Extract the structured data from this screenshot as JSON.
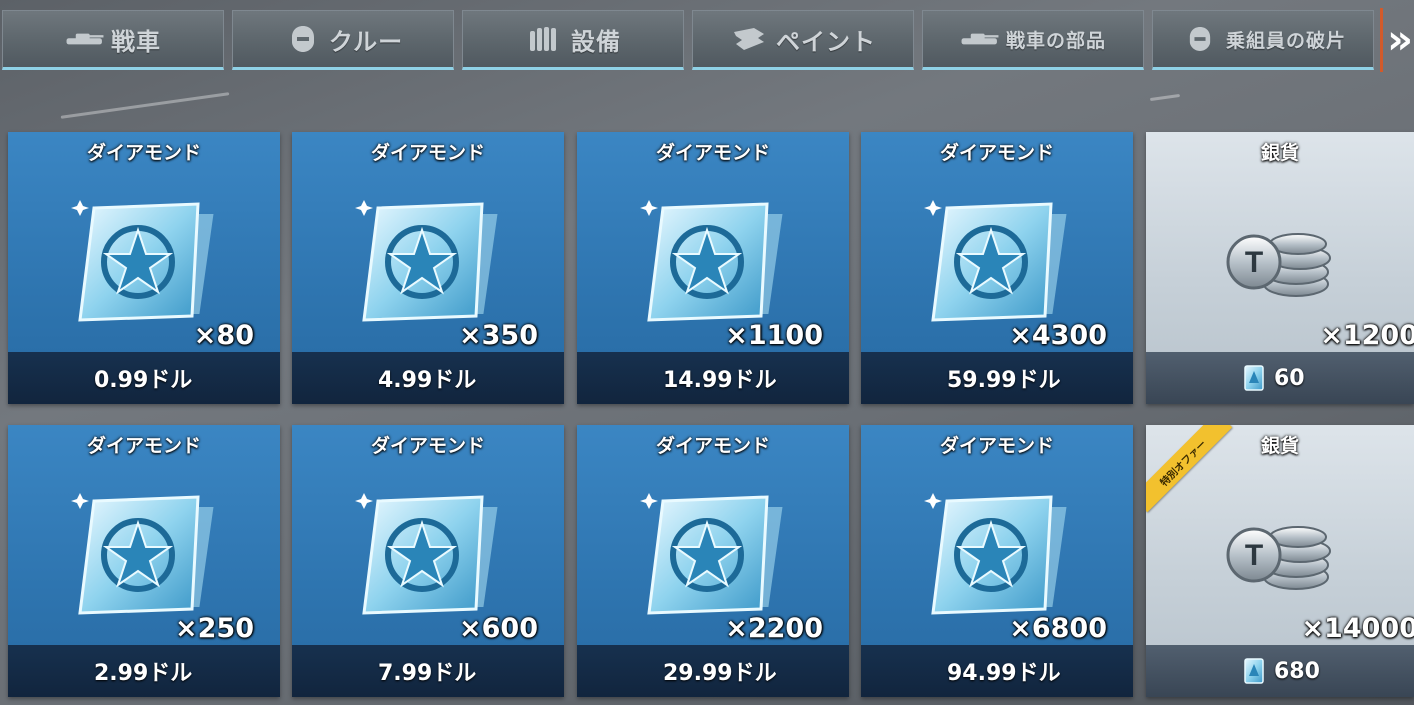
{
  "tabs": [
    {
      "label": "戦車",
      "icon": "tank-icon"
    },
    {
      "label": "クルー",
      "icon": "crew-helmet-icon"
    },
    {
      "label": "設備",
      "icon": "shells-icon"
    },
    {
      "label": "ペイント",
      "icon": "paint-icon"
    },
    {
      "label": "戦車の部品",
      "icon": "tank-icon"
    },
    {
      "label": "乗組員の破片",
      "icon": "crew-helmet-icon"
    }
  ],
  "more_tabs_glyph": "»",
  "products": [
    {
      "title": "ダイアモンド",
      "quantity": "×80",
      "price": "0.99ドル",
      "type": "diamond"
    },
    {
      "title": "ダイアモンド",
      "quantity": "×350",
      "price": "4.99ドル",
      "type": "diamond"
    },
    {
      "title": "ダイアモンド",
      "quantity": "×1100",
      "price": "14.99ドル",
      "type": "diamond"
    },
    {
      "title": "ダイアモンド",
      "quantity": "×4300",
      "price": "59.99ドル",
      "type": "diamond"
    },
    {
      "title": "銀貨",
      "quantity": "×1200",
      "price": "60",
      "type": "silver"
    },
    {
      "title": "ダイアモンド",
      "quantity": "×250",
      "price": "2.99ドル",
      "type": "diamond"
    },
    {
      "title": "ダイアモンド",
      "quantity": "×600",
      "price": "7.99ドル",
      "type": "diamond"
    },
    {
      "title": "ダイアモンド",
      "quantity": "×2200",
      "price": "29.99ドル",
      "type": "diamond"
    },
    {
      "title": "ダイアモンド",
      "quantity": "×6800",
      "price": "94.99ドル",
      "type": "diamond"
    },
    {
      "title": "銀貨",
      "quantity": "×14000",
      "price": "680",
      "type": "silver",
      "ribbon": "特別オファー"
    }
  ],
  "colors": {
    "card_blue": "#2f76b1",
    "card_silver": "#c6d0d8",
    "tab_underline": "#8fd1e6",
    "ribbon": "#f2c12e",
    "more_tab_accent": "#d25a2a"
  }
}
